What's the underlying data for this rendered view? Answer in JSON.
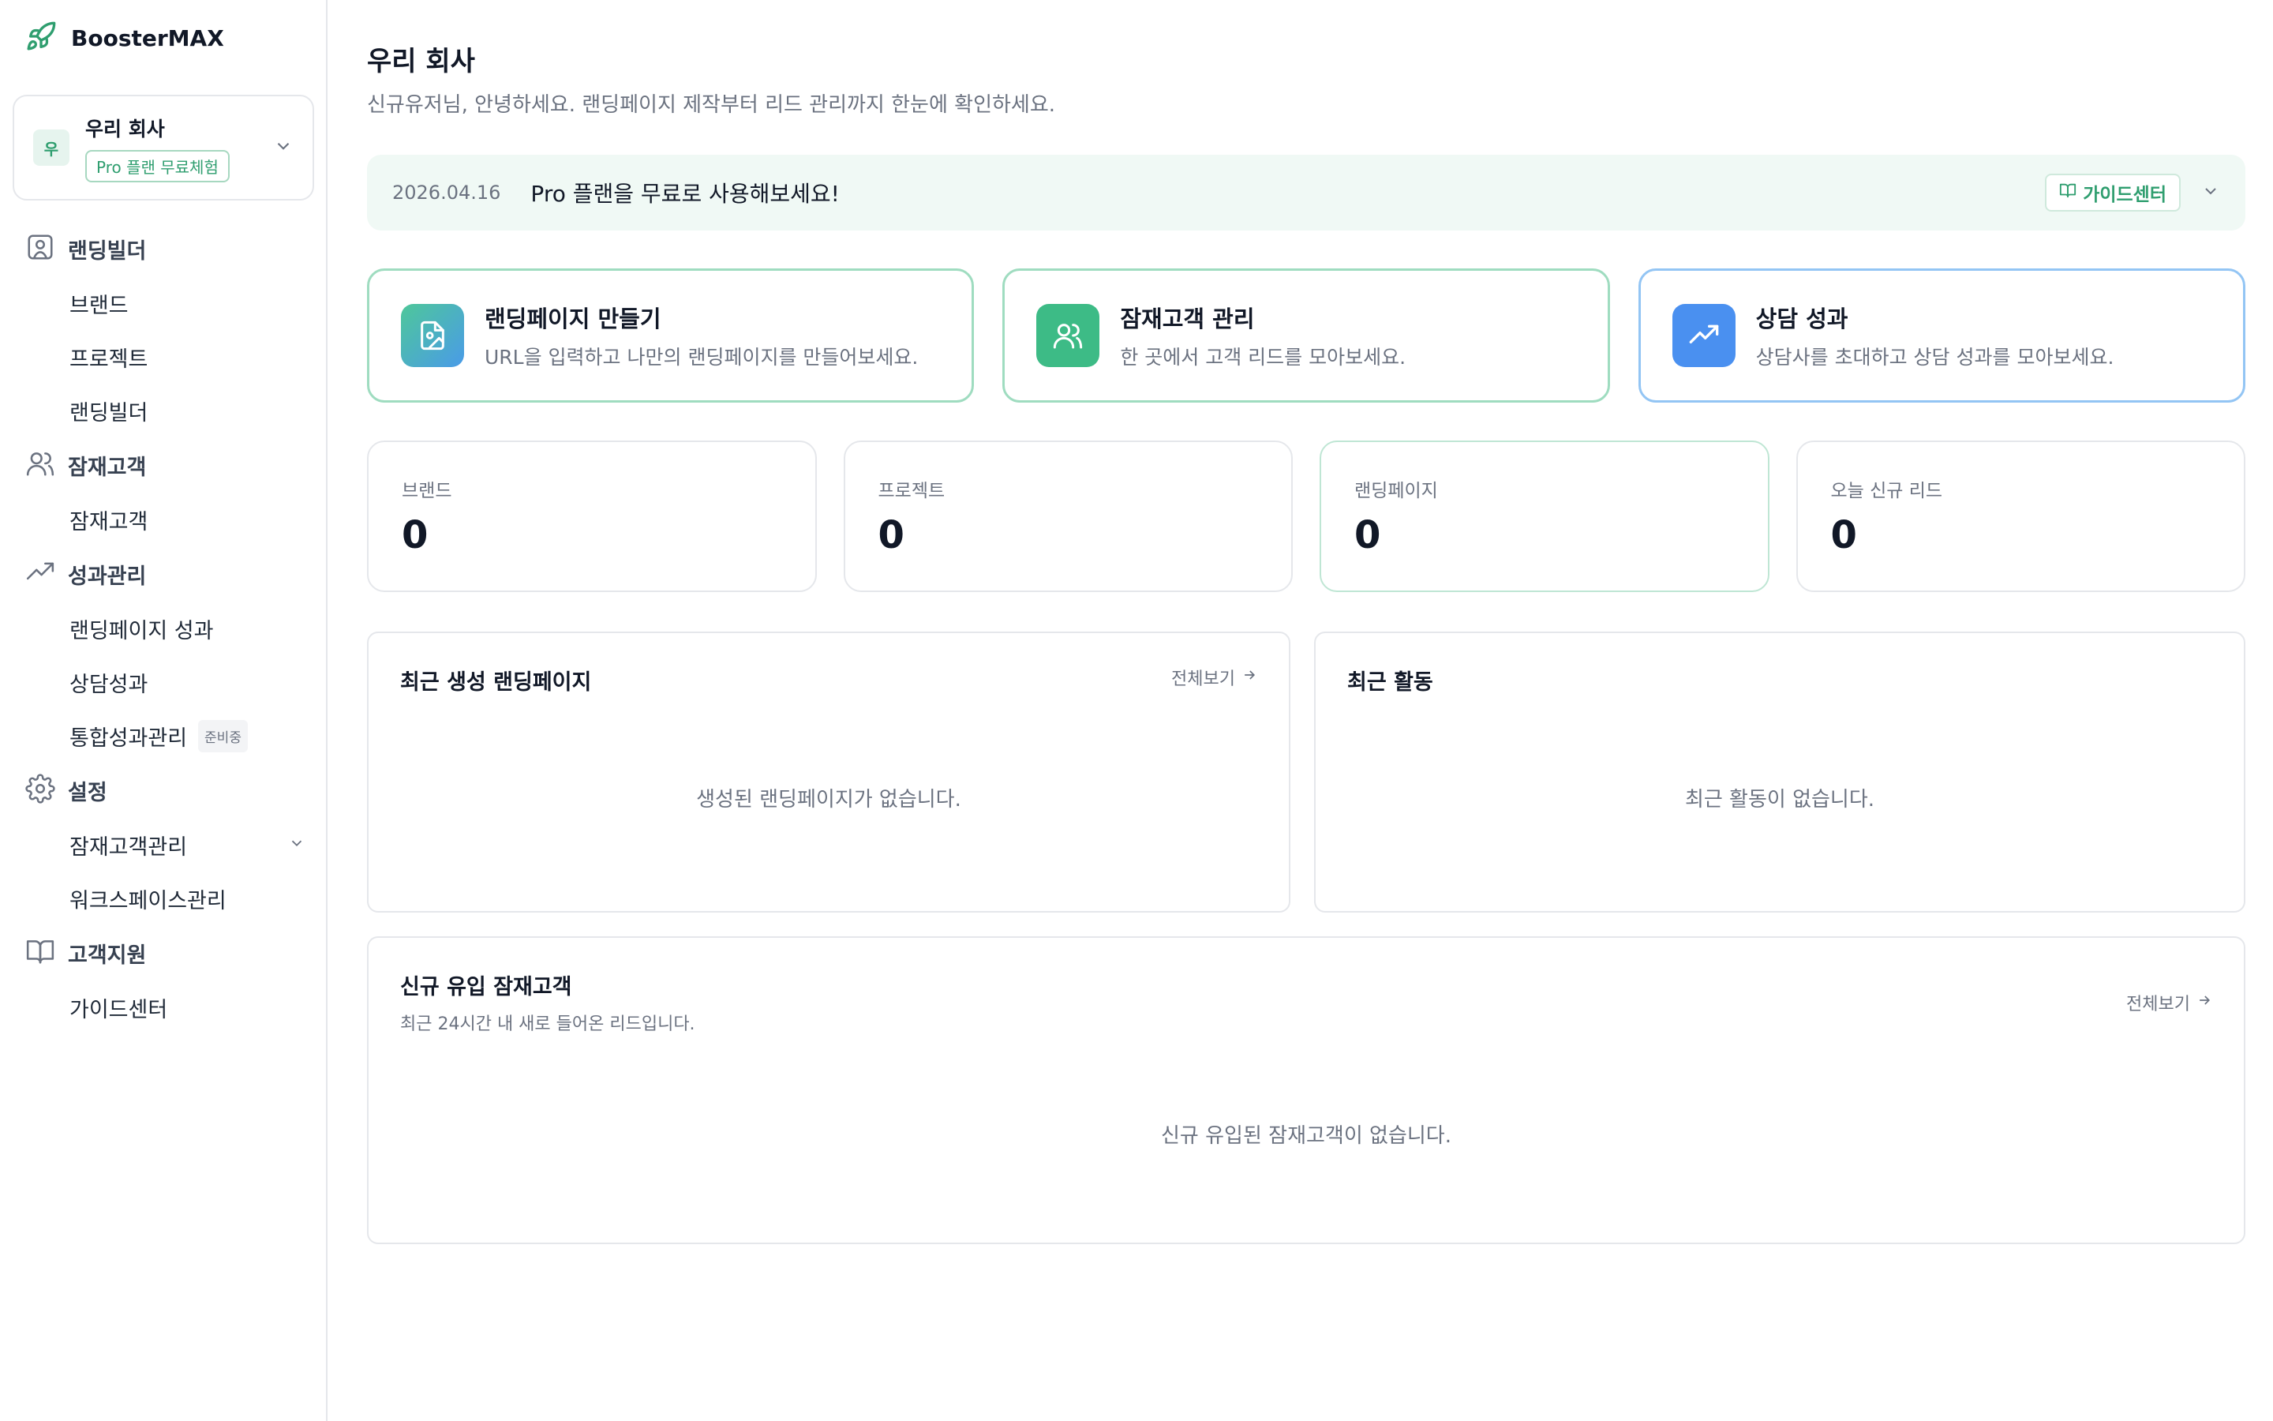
{
  "brand": {
    "name": "BoosterMAX"
  },
  "workspace": {
    "avatar_letter": "우",
    "name": "우리 회사",
    "plan_badge": "Pro 플랜 무료체험"
  },
  "nav": {
    "landing_builder_group": "랜딩빌더",
    "brand_item": "브랜드",
    "project_item": "프로젝트",
    "landing_builder_item": "랜딩빌더",
    "leads_group": "잠재고객",
    "leads_item": "잠재고객",
    "performance_group": "성과관리",
    "landing_perf_item": "랜딩페이지 성과",
    "consult_perf_item": "상담성과",
    "integrated_perf_item": "통합성과관리",
    "integrated_perf_badge": "준비중",
    "settings_group": "설정",
    "lead_mgmt_item": "잠재고객관리",
    "workspace_mgmt_item": "워크스페이스관리",
    "support_group": "고객지원",
    "guide_center_item": "가이드센터"
  },
  "header": {
    "title": "우리 회사",
    "subtitle": "신규유저님, 안녕하세요. 랜딩페이지 제작부터 리드 관리까지 한눈에 확인하세요."
  },
  "notice": {
    "date": "2026.04.16",
    "text": "Pro 플랜을 무료로 사용해보세요!",
    "guide_button": "가이드센터"
  },
  "actions": [
    {
      "title": "랜딩페이지 만들기",
      "desc": "URL을 입력하고 나만의 랜딩페이지를 만들어보세요."
    },
    {
      "title": "잠재고객 관리",
      "desc": "한 곳에서 고객 리드를 모아보세요."
    },
    {
      "title": "상담 성과",
      "desc": "상담사를 초대하고 상담 성과를 모아보세요."
    }
  ],
  "stats": [
    {
      "label": "브랜드",
      "value": "0"
    },
    {
      "label": "프로젝트",
      "value": "0"
    },
    {
      "label": "랜딩페이지",
      "value": "0"
    },
    {
      "label": "오늘 신규 리드",
      "value": "0"
    }
  ],
  "recent_pages": {
    "title": "최근 생성 랜딩페이지",
    "view_all": "전체보기",
    "empty": "생성된 랜딩페이지가 없습니다."
  },
  "recent_activity": {
    "title": "최근 활동",
    "empty": "최근 활동이 없습니다."
  },
  "new_leads": {
    "title": "신규 유입 잠재고객",
    "subtitle": "최근 24시간 내 새로 들어온 리드입니다.",
    "view_all": "전체보기",
    "empty": "신규 유입된 잠재고객이 없습니다."
  },
  "colors": {
    "accent_green": "#2f9e6f",
    "accent_blue": "#4a90f0",
    "notice_bg": "#f0f9f5"
  },
  "icons": [
    "rocket-icon",
    "image-icon",
    "users-icon",
    "trending-up-icon",
    "gear-icon",
    "book-open-icon",
    "chevron-down-icon",
    "arrow-right-icon",
    "file-image-icon"
  ]
}
